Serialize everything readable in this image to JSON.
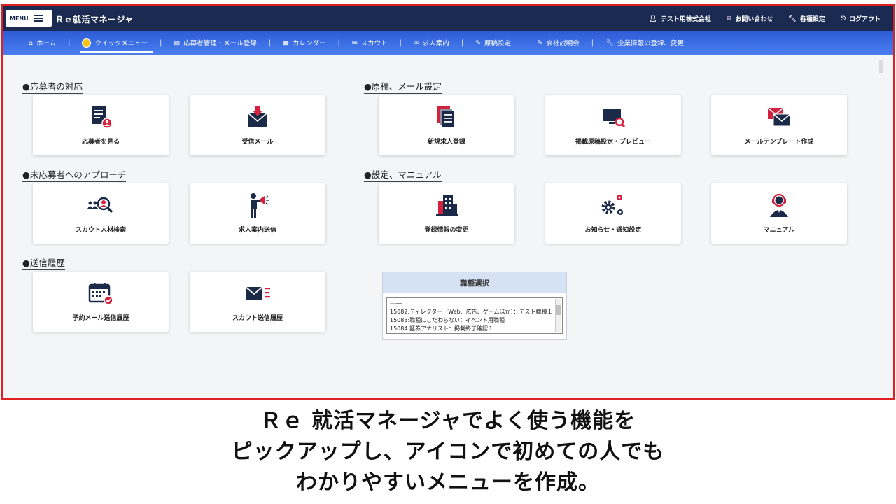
{
  "topbar": {
    "menu_label": "MENU",
    "app_title": "Ｒｅ就活マネージャ",
    "links": [
      {
        "icon": "user-icon",
        "label": "テスト用株式会社"
      },
      {
        "icon": "mail-icon",
        "label": "お問い合わせ"
      },
      {
        "icon": "wrench-icon",
        "label": "各種設定"
      },
      {
        "icon": "logout-icon",
        "label": "ログアウト"
      }
    ]
  },
  "nav": {
    "items": [
      {
        "icon": "home-icon",
        "label": "ホーム"
      },
      {
        "icon": "coin-icon",
        "label": "クイックメニュー",
        "active": true
      },
      {
        "icon": "list-icon",
        "label": "応募者管理・メール登録"
      },
      {
        "icon": "calendar-icon",
        "label": "カレンダー"
      },
      {
        "icon": "mail-icon",
        "label": "スカウト"
      },
      {
        "icon": "mail-icon",
        "label": "求人案内"
      },
      {
        "icon": "pencil-icon",
        "label": "原稿設定"
      },
      {
        "icon": "pencil-icon",
        "label": "会社説明会"
      },
      {
        "icon": "wrench-icon",
        "label": "企業情報の登録、変更"
      }
    ],
    "separator": "|"
  },
  "sections": {
    "applicants": {
      "title": "●応募者の対応",
      "cards": [
        {
          "label": "応募者を見る",
          "icon": "applicant-doc-icon"
        },
        {
          "label": "受信メール",
          "icon": "inbox-mail-icon"
        }
      ]
    },
    "manuscript": {
      "title": "●原稿、メール設定",
      "cards": [
        {
          "label": "新規求人登録",
          "icon": "documents-icon"
        },
        {
          "label": "掲載原稿設定・プレビュー",
          "icon": "monitor-search-icon"
        },
        {
          "label": "メールテンプレート作成",
          "icon": "mail-template-icon"
        }
      ]
    },
    "approach": {
      "title": "●未応募者へのアプローチ",
      "cards": [
        {
          "label": "スカウト人材検索",
          "icon": "people-search-icon"
        },
        {
          "label": "求人案内送信",
          "icon": "megaphone-person-icon"
        }
      ]
    },
    "settings": {
      "title": "●設定、マニュアル",
      "cards": [
        {
          "label": "登録情報の変更",
          "icon": "building-icon"
        },
        {
          "label": "お知らせ・通知設定",
          "icon": "gears-icon"
        },
        {
          "label": "マニュアル",
          "icon": "support-person-icon"
        }
      ]
    },
    "history": {
      "title": "●送信履歴",
      "cards": [
        {
          "label": "予約メール送信履歴",
          "icon": "calendar-check-icon"
        },
        {
          "label": "スカウト送信履歴",
          "icon": "sent-mail-icon"
        }
      ]
    }
  },
  "job_panel": {
    "title": "職種選択",
    "options": [
      "------",
      "15082:ディレクター（Web、広告、ゲームほか）：テスト職種１",
      "15083:職種にこだわらない：イベント用職種",
      "15084:証券アナリスト：掲載終了確認１"
    ]
  },
  "caption": {
    "lines": [
      "Ｒｅ 就活マネージャでよく使う機能を",
      "ピックアップし、アイコンで初めての人でも",
      "わかりやすいメニューを作成。"
    ]
  },
  "colors": {
    "topbar": "#1a2a50",
    "nav": "#3a6be0",
    "accent_red": "#d4213d",
    "icon_navy": "#1c2a4a",
    "frame_border": "#e02020"
  }
}
